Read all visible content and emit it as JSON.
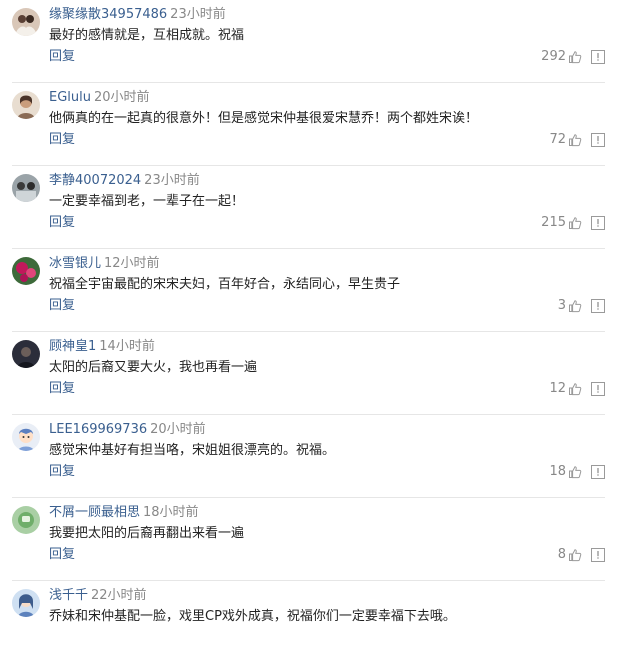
{
  "reply_label": "回复",
  "colors": {
    "username": "#3a5f8f",
    "time": "#888888",
    "text": "#222222",
    "divider": "#e6e6e6"
  },
  "comments": [
    {
      "username": "缘聚缘散34957486",
      "time": "23小时前",
      "text": "最好的感情就是，互相成就。祝福",
      "likes": "292",
      "avatar": "avatar-wedding-couple"
    },
    {
      "username": "EGlulu",
      "time": "20小时前",
      "text": "他俩真的在一起真的很意外！但是感觉宋仲基很爱宋慧乔！两个都姓宋诶！",
      "likes": "72",
      "avatar": "avatar-portrait"
    },
    {
      "username": "李静40072024",
      "time": "23小时前",
      "text": "一定要幸福到老，一辈子在一起！",
      "likes": "215",
      "avatar": "avatar-group-photo"
    },
    {
      "username": "冰雪银儿",
      "time": "12小时前",
      "text": "祝福全宇宙最配的宋宋夫妇，百年好合，永结同心，早生贵子",
      "likes": "3",
      "avatar": "avatar-flowers"
    },
    {
      "username": "顾神皇1",
      "time": "14小时前",
      "text": "太阳的后裔又要大火，我也再看一遍",
      "likes": "12",
      "avatar": "avatar-dark-portrait"
    },
    {
      "username": "LEE169969736",
      "time": "20小时前",
      "text": "感觉宋仲基好有担当咯，宋姐姐很漂亮的。祝福。",
      "likes": "18",
      "avatar": "avatar-cartoon"
    },
    {
      "username": "不屑一顾最相思",
      "time": "18小时前",
      "text": "我要把太阳的后裔再翻出来看一遍",
      "likes": "8",
      "avatar": "avatar-green-cartoon"
    },
    {
      "username": "浅千千",
      "time": "22小时前",
      "text": "乔妹和宋仲基配一脸，戏里CP戏外成真，祝福你们一定要幸福下去哦。",
      "likes": "",
      "avatar": "avatar-blue-girl"
    }
  ]
}
